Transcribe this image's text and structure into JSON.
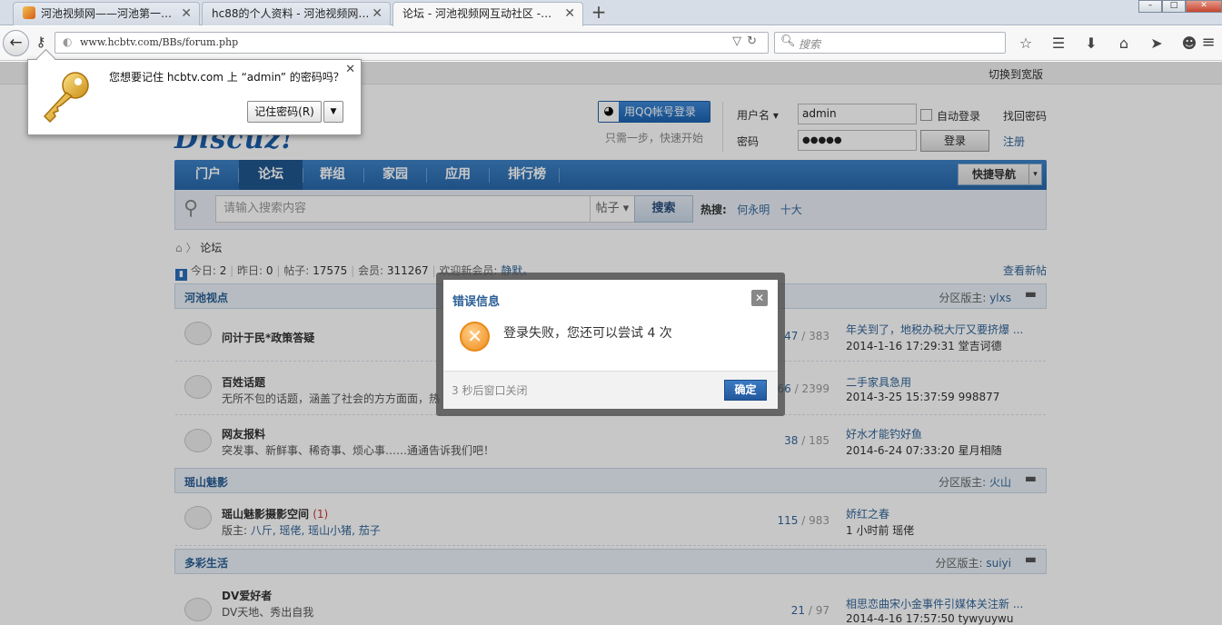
{
  "browser": {
    "tabs": [
      {
        "title": "河池视频网——河池第一…"
      },
      {
        "title": "hc88的个人资料 - 河池视频网…"
      },
      {
        "title": "论坛 - 河池视频网互动社区 -…"
      }
    ],
    "url": "www.hcbtv.com/BBs/forum.php",
    "search_placeholder": "搜索"
  },
  "password_prompt": {
    "message": "您想要记住 hcbtv.com 上 “admin” 的密码吗？",
    "remember_label": "记住密码(R)"
  },
  "page": {
    "wide_link": "切换到宽版",
    "logo": "Discuz!",
    "qq_login": "用QQ帐号登录",
    "qq_hint": "只需一步，快速开始",
    "login": {
      "username_label": "用户名",
      "username_value": "admin",
      "password_label": "密码",
      "password_value": "●●●●●",
      "auto_login": "自动登录",
      "find_password": "找回密码",
      "login_button": "登录",
      "register": "注册"
    },
    "nav": [
      "门户",
      "论坛",
      "群组",
      "家园",
      "应用",
      "排行榜"
    ],
    "quick_nav": "快捷导航",
    "search": {
      "placeholder": "请输入搜索内容",
      "type": "帖子",
      "button": "搜索",
      "hot_label": "热搜:",
      "hot": [
        "何永明",
        "十大"
      ]
    },
    "breadcrumb": "论坛",
    "stats": {
      "today_label": "今日:",
      "today": "2",
      "yesterday_label": "昨日:",
      "yesterday": "0",
      "posts_label": "帖子:",
      "posts": "17575",
      "members_label": "会员:",
      "members": "311267",
      "welcome_label": "欢迎新会员:",
      "welcome": "静默。"
    },
    "view_new": "查看新帖",
    "categories": [
      {
        "title": "河池视点",
        "mod_label": "分区版主:",
        "mod": "ylxs",
        "forums": [
          {
            "name": "问计于民*政策答疑",
            "desc": "",
            "threads": "47",
            "posts": "383",
            "last": "年关到了，地税办税大厅又要挤爆 ...",
            "time": "2014-1-16 17:29:31 堂吉诃德"
          },
          {
            "name": "百姓话题",
            "desc": "无所不包的话题，涵盖了社会的方方面面，热",
            "threads": "66",
            "posts": "2399",
            "last": "二手家具急用",
            "time": "2014-3-25 15:37:59 998877"
          },
          {
            "name": "网友报料",
            "desc": "突发事、新鲜事、稀奇事、烦心事……通通告诉我们吧！",
            "threads": "38",
            "posts": "185",
            "last": "好水才能钓好鱼",
            "time": "2014-6-24 07:33:20 星月相随"
          }
        ]
      },
      {
        "title": "瑶山魅影",
        "mod_label": "分区版主:",
        "mod": "火山",
        "forums": [
          {
            "name": "瑶山魅影摄影空间",
            "badge": "(1)",
            "desc_label": "版主:",
            "desc": "八斤, 瑶佬, 瑶山小猪, 茄子",
            "threads": "115",
            "posts": "983",
            "last": "娇红之春",
            "time": "1 小时前 瑶佬"
          }
        ]
      },
      {
        "title": "多彩生活",
        "mod_label": "分区版主:",
        "mod": "suiyi",
        "forums": [
          {
            "name": "DV爱好者",
            "desc": "DV天地、秀出自我",
            "threads": "21",
            "posts": "97",
            "last": "相思恋曲宋小金事件引媒体关注新 ...",
            "time": "2014-4-16 17:57:50 tywyuywu"
          }
        ]
      }
    ]
  },
  "dialog": {
    "title": "错误信息",
    "message": "登录失败，您还可以尝试 4 次",
    "countdown": "3 秒后窗口关闭",
    "ok": "确定"
  }
}
